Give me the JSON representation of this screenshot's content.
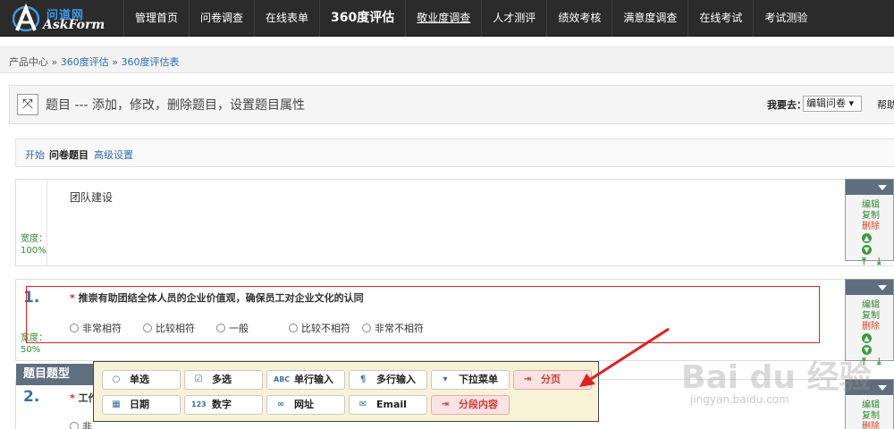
{
  "logo": {
    "cn": "问道网",
    "en": "AskForm"
  },
  "nav": [
    "管理首页",
    "问卷调查",
    "在线表单",
    "360度评估",
    "敬业度调查",
    "人才测评",
    "绩效考核",
    "满意度调查",
    "在线考试",
    "考试测验"
  ],
  "breadcrumb": {
    "home": "产品中心",
    "sep": "»",
    "level1": "360度评估",
    "level2": "360度评估表"
  },
  "header": {
    "title": "题目 --- 添加，修改，删除题目，设置题目属性",
    "goto_label": "我要去：",
    "goto_value": "编辑问卷",
    "help": "帮助"
  },
  "tabs": [
    "开始",
    "问卷题目",
    "高级设置"
  ],
  "groups": [
    {
      "title": "团队建设",
      "width_label": "宽度：",
      "width_value": "100%"
    }
  ],
  "questions": [
    {
      "number": "1.",
      "required_mark": "*",
      "text": "推崇有助团结全体人员的企业价值观，确保员工对企业文化的认同",
      "options": [
        "非常相符",
        "比较相符",
        "一般",
        "比较不相符",
        "非常不相符"
      ],
      "width_label": "宽度：",
      "width_value": "50%"
    },
    {
      "number": "2.",
      "required_mark": "*",
      "text": "工作",
      "option_fragment": "非"
    }
  ],
  "controls": {
    "edit": "编辑",
    "copy": "复制",
    "delete": "删除"
  },
  "type_panel": {
    "tag": "题目题型",
    "buttons": [
      {
        "label": "单选",
        "icon": "radio-icon"
      },
      {
        "label": "多选",
        "icon": "checkbox-icon"
      },
      {
        "label": "单行输入",
        "icon": "abc-icon"
      },
      {
        "label": "多行输入",
        "icon": "multiline-icon"
      },
      {
        "label": "下拉菜单",
        "icon": "dropdown-icon"
      },
      {
        "label": "分页",
        "icon": "page-break-icon"
      },
      {
        "label": "日期",
        "icon": "calendar-icon"
      },
      {
        "label": "数字",
        "icon": "number-icon"
      },
      {
        "label": "网址",
        "icon": "link-icon"
      },
      {
        "label": "Email",
        "icon": "email-icon"
      },
      {
        "label": "分段内容",
        "icon": "section-icon"
      }
    ]
  },
  "watermark": {
    "main": "Bai du 经验",
    "url": "jingyan.baidu.com"
  },
  "colors": {
    "nav_bg": "#2b2b2b",
    "link": "#2a6fb5",
    "width_green": "#2e8b2e",
    "annotation_red": "#e02020",
    "popup_bg": "#f8f3d6"
  }
}
